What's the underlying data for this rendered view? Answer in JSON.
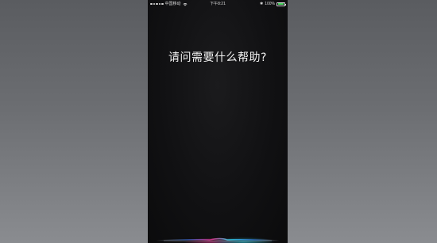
{
  "status_bar": {
    "carrier": "中国移动",
    "time": "下午8:21",
    "battery_percent": "100%",
    "battery_level": 1.0,
    "icons": [
      "signal-icon",
      "wifi-icon",
      "bluetooth-icon",
      "battery-icon"
    ]
  },
  "siri": {
    "prompt": "请问需要什么帮助?",
    "wave_colors": [
      "#2fc9e0",
      "#e0338d",
      "#3a7bff",
      "#ffffff"
    ]
  }
}
